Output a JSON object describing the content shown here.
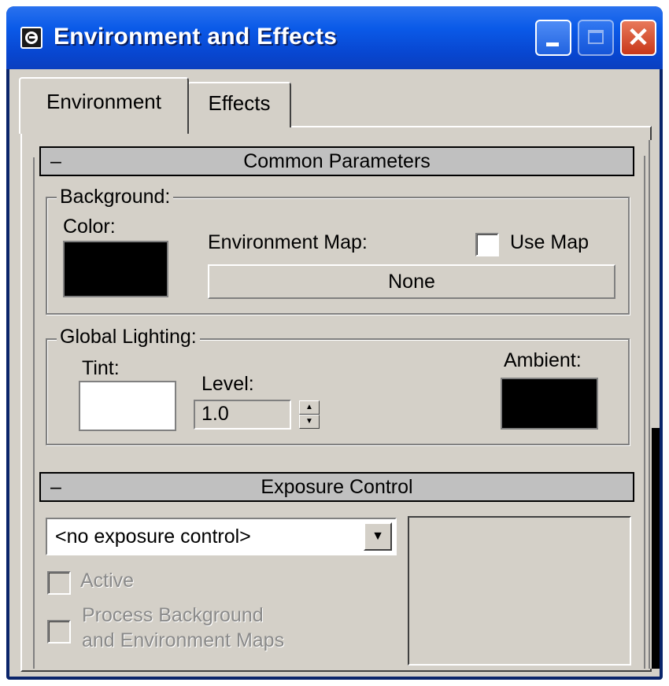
{
  "window": {
    "title": "Environment and Effects",
    "app_icon": "3ds-max-icon",
    "controls": {
      "minimize": "minimize-icon",
      "maximize": "maximize-icon",
      "close": "close-icon",
      "close_glyph": "✕"
    }
  },
  "tabs": [
    {
      "label": "Environment",
      "active": true
    },
    {
      "label": "Effects",
      "active": false
    }
  ],
  "common_parameters": {
    "header": "Common Parameters",
    "collapse_glyph": "–",
    "background": {
      "group_label": "Background:",
      "color_label": "Color:",
      "color": "#000000",
      "env_map_label": "Environment Map:",
      "use_map_label": "Use Map",
      "use_map_checked": false,
      "map_button_label": "None"
    },
    "global_lighting": {
      "group_label": "Global Lighting:",
      "tint_label": "Tint:",
      "tint_color": "#ffffff",
      "level_label": "Level:",
      "level_value": "1.0",
      "ambient_label": "Ambient:",
      "ambient_color": "#000000"
    }
  },
  "exposure_control": {
    "header": "Exposure Control",
    "collapse_glyph": "–",
    "selected": "<no exposure control>",
    "active_label": "Active",
    "active_checked": false,
    "process_bg_line1": "Process Background",
    "process_bg_line2": "and Environment Maps",
    "process_bg_checked": false
  },
  "colors": {
    "title_bar": "#0a5ae8",
    "dialog_bg": "#d4d0c8",
    "close_button": "#c8381a"
  }
}
